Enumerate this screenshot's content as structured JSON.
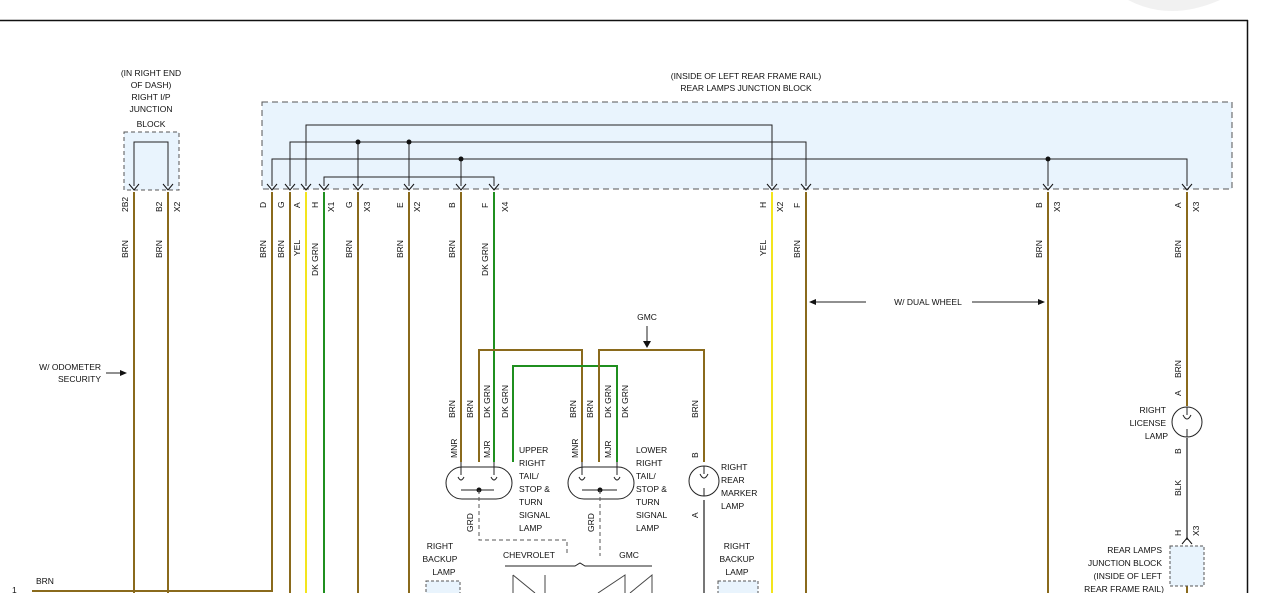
{
  "colors": {
    "BRN": "#8a6a1c",
    "YEL": "#f3e51d",
    "DK GRN": "#1f8f1f",
    "BLK": "#777777",
    "GRY": "#999999",
    "block_fill": "#e9f4fd"
  },
  "right_ip_block": {
    "label_lines": [
      "(IN RIGHT END",
      "OF DASH)",
      "RIGHT I/P",
      "JUNCTION",
      "BLOCK"
    ],
    "pins": [
      {
        "pin": "2B2",
        "wire": "BRN"
      },
      {
        "pin": "B2",
        "wire": "BRN"
      },
      {
        "pin": "X2",
        "wire": ""
      }
    ]
  },
  "rear_block": {
    "label_lines": [
      "(INSIDE OF LEFT REAR FRAME RAIL)",
      "REAR LAMPS JUNCTION BLOCK"
    ],
    "pins": [
      {
        "pin": "D",
        "wire": "BRN"
      },
      {
        "pin": "G",
        "wire": "BRN"
      },
      {
        "pin": "A",
        "wire": "YEL"
      },
      {
        "pin": "H",
        "wire": "DK GRN"
      },
      {
        "pin": "X1",
        "wire": ""
      },
      {
        "pin": "G",
        "wire": "BRN"
      },
      {
        "pin": "X3",
        "wire": ""
      },
      {
        "pin": "E",
        "wire": "BRN"
      },
      {
        "pin": "X2",
        "wire": ""
      },
      {
        "pin": "B",
        "wire": "BRN"
      },
      {
        "pin": "F",
        "wire": "DK GRN"
      },
      {
        "pin": "X4",
        "wire": ""
      },
      {
        "pin": "H",
        "wire": "YEL"
      },
      {
        "pin": "X2",
        "wire": ""
      },
      {
        "pin": "F",
        "wire": "BRN"
      },
      {
        "pin": "B",
        "wire": "BRN"
      },
      {
        "pin": "X3",
        "wire": ""
      },
      {
        "pin": "A",
        "wire": "BRN"
      },
      {
        "pin": "X3",
        "wire": ""
      }
    ]
  },
  "annotations": {
    "odometer": [
      "W/ ODOMETER",
      "SECURITY"
    ],
    "dual_wheel": "W/ DUAL WHEEL",
    "gmc_top": "GMC",
    "chevrolet": "CHEVROLET",
    "gmc_bottom": "GMC"
  },
  "lamps": {
    "upper": {
      "label_lines": [
        "UPPER",
        "RIGHT",
        "TAIL/",
        "STOP &",
        "TURN",
        "SIGNAL",
        "LAMP"
      ],
      "pins": [
        "MNR",
        "MJR"
      ],
      "wires": [
        "BRN",
        "BRN",
        "DK GRN",
        "DK GRN"
      ],
      "ground": "GRD"
    },
    "lower": {
      "label_lines": [
        "LOWER",
        "RIGHT",
        "TAIL/",
        "STOP &",
        "TURN",
        "SIGNAL",
        "LAMP"
      ],
      "pins": [
        "MNR",
        "MJR"
      ],
      "wires": [
        "BRN",
        "BRN",
        "DK GRN",
        "DK GRN"
      ],
      "ground": "GRD"
    },
    "marker": {
      "label_lines": [
        "RIGHT",
        "REAR",
        "MARKER",
        "LAMP"
      ],
      "pin_top": "B",
      "pin_bottom": "A",
      "wire": "BRN"
    },
    "backup_left": {
      "label_lines": [
        "RIGHT",
        "BACKUP",
        "LAMP"
      ]
    },
    "backup_right": {
      "label_lines": [
        "RIGHT",
        "BACKUP",
        "LAMP"
      ]
    },
    "license": {
      "label_lines": [
        "RIGHT",
        "LICENSE",
        "LAMP"
      ],
      "pin_top": "A",
      "pin_bottom": "B",
      "wire_top": "BRN",
      "wire_bottom": "BLK"
    },
    "junction2": {
      "label_lines": [
        "REAR LAMPS",
        "JUNCTION BLOCK",
        "(INSIDE OF LEFT",
        "REAR FRAME RAIL)"
      ],
      "pins": [
        "H",
        "X3"
      ]
    }
  },
  "bottom": {
    "row_number": "1",
    "wire": "BRN"
  }
}
